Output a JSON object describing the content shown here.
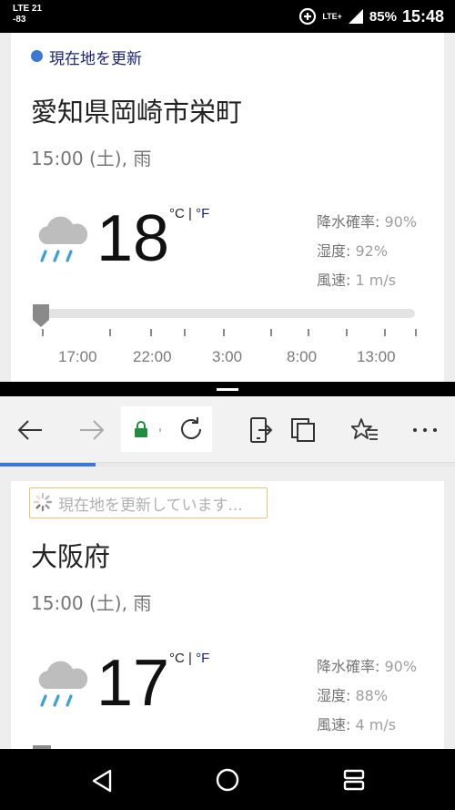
{
  "status_bar": {
    "network_left_line1": "LTE 21",
    "network_left_line2": "-83",
    "network_type": "LTE+",
    "battery": "85%",
    "time": "15:48"
  },
  "top_pane": {
    "update_link": "現在地を更新",
    "location": "愛知県岡崎市栄町",
    "datetime": "15:00 (土), 雨",
    "temperature": "18",
    "unit_c": "°C",
    "unit_sep": " | ",
    "unit_f": "°F",
    "precip_label": "降水確率:",
    "precip_value": " 90%",
    "humidity_label": "湿度:",
    "humidity_value": " 92%",
    "wind_label": "風速:",
    "wind_value": " 1 m/s",
    "timeline_labels": [
      "17:00",
      "22:00",
      "3:00",
      "8:00",
      "13:00"
    ],
    "weather_icon": "rain-cloud-icon"
  },
  "browser_toolbar": {
    "icons": [
      "back-arrow-icon",
      "forward-arrow-icon",
      "lock-icon",
      "refresh-icon",
      "share-icon",
      "tabs-icon",
      "favorites-star-icon",
      "more-icon"
    ],
    "page_load_progress": 0.21
  },
  "bottom_pane": {
    "update_status": "現在地を更新しています...",
    "location": "大阪府",
    "datetime": "15:00 (土), 雨",
    "temperature": "17",
    "unit_c": "°C",
    "unit_sep": " | ",
    "unit_f": "°F",
    "precip_label": "降水確率:",
    "precip_value": " 90%",
    "humidity_label": "湿度:",
    "humidity_value": " 88%",
    "wind_label": "風速:",
    "wind_value": " 4 m/s",
    "weather_icon": "rain-cloud-icon"
  },
  "nav_bar": {
    "icons": [
      "back-triangle-icon",
      "home-circle-icon",
      "recents-icon"
    ]
  },
  "colors": {
    "accent_blue": "#3b78d6",
    "link_dark_blue": "#1a237e",
    "lock_green": "#1e8e3e",
    "rain_blue": "#3aa0d8"
  }
}
